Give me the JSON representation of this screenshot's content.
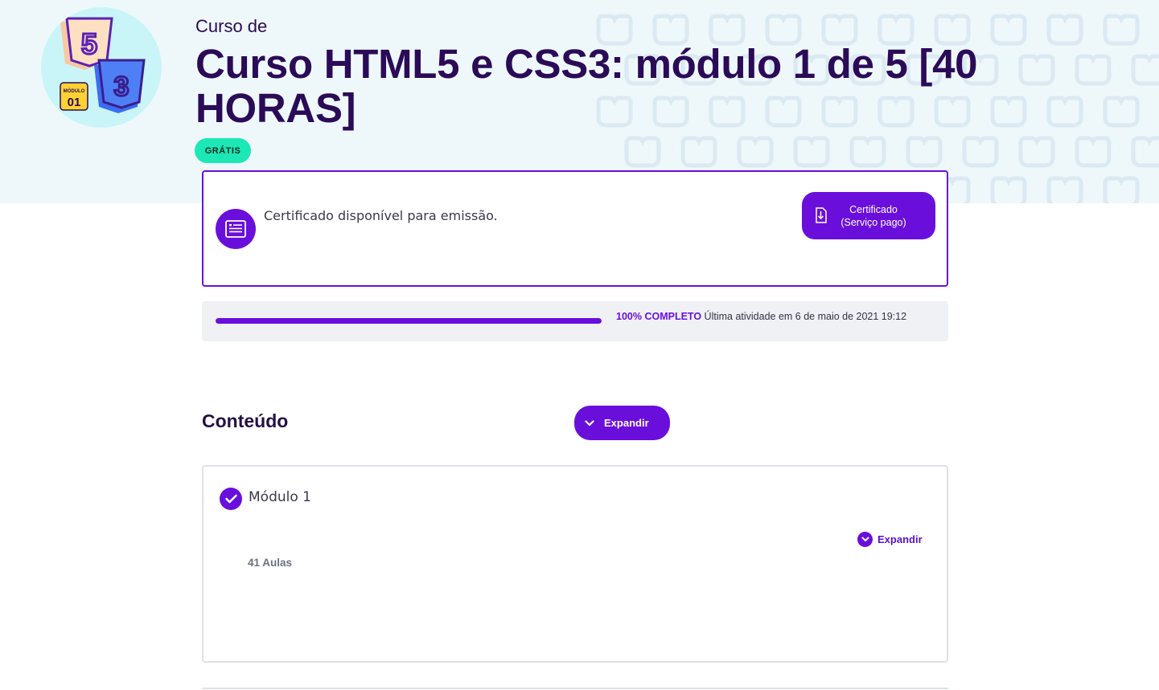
{
  "hero": {
    "kicker": "Curso de",
    "title": "Curso HTML5 e CSS3: módulo 1 de 5 [40 HORAS]",
    "badge": "GRÁTIS",
    "logo": {
      "module_tag_top": "MÓDULO",
      "module_tag_number": "01",
      "icons": [
        "html5-icon",
        "css3-icon"
      ]
    }
  },
  "certificate": {
    "message": "Certificado disponível para emissão.",
    "button_line1": "Certificado",
    "button_line2": "(Serviço pago)"
  },
  "progress": {
    "percent_value": 100,
    "percent_label": "100% COMPLETO",
    "last_activity": "Última atividade em 6 de maio de 2021 19:12"
  },
  "content": {
    "section_title": "Conteúdo",
    "expand_all_label": "Expandir",
    "modules": [
      {
        "title": "Módulo 1",
        "lessons": "41 Aulas",
        "expand_label": "Expandir",
        "completed": true
      }
    ]
  },
  "colors": {
    "accent": "#6a0fdb",
    "title": "#2b0b57",
    "badge": "#1ce8b5",
    "hero_bg": "#eef8fb"
  }
}
